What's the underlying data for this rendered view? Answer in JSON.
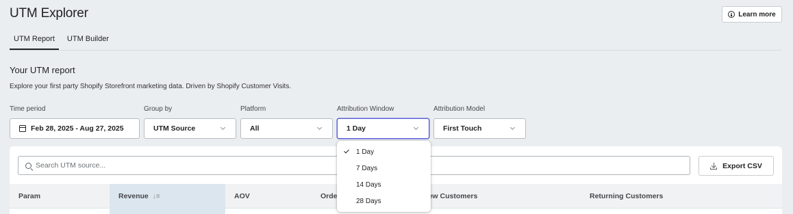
{
  "app": {
    "title": "UTM Explorer",
    "learn_more": "Learn more"
  },
  "tabs": [
    {
      "label": "UTM Report",
      "active": true
    },
    {
      "label": "UTM Builder",
      "active": false
    }
  ],
  "report": {
    "heading": "Your UTM report",
    "description": "Explore your first party Shopify Storefront marketing data. Driven by Shopify Customer Visits."
  },
  "filters": {
    "time_period": {
      "label": "Time period",
      "value": "Feb 28, 2025 - Aug 27, 2025",
      "icon": "calendar-icon"
    },
    "group_by": {
      "label": "Group by",
      "value": "UTM Source"
    },
    "platform": {
      "label": "Platform",
      "value": "All"
    },
    "attribution_window": {
      "label": "Attribution Window",
      "value": "1 Day"
    },
    "attribution_model": {
      "label": "Attribution Model",
      "value": "First Touch"
    }
  },
  "dropdown": {
    "options": [
      "1 Day",
      "7 Days",
      "14 Days",
      "28 Days"
    ],
    "selected": "1 Day"
  },
  "table": {
    "search_placeholder": "Search UTM source...",
    "export_label": "Export CSV",
    "columns": [
      "Param",
      "Revenue",
      "AOV",
      "Orde",
      "New Customers",
      "Returning Customers"
    ],
    "sorted_column": "Revenue",
    "sort_icon": "↓≡"
  },
  "colors": {
    "focus_border": "#5a5fd6",
    "sorted_header": "#dce6ee",
    "page_bg": "#ebeef1"
  }
}
